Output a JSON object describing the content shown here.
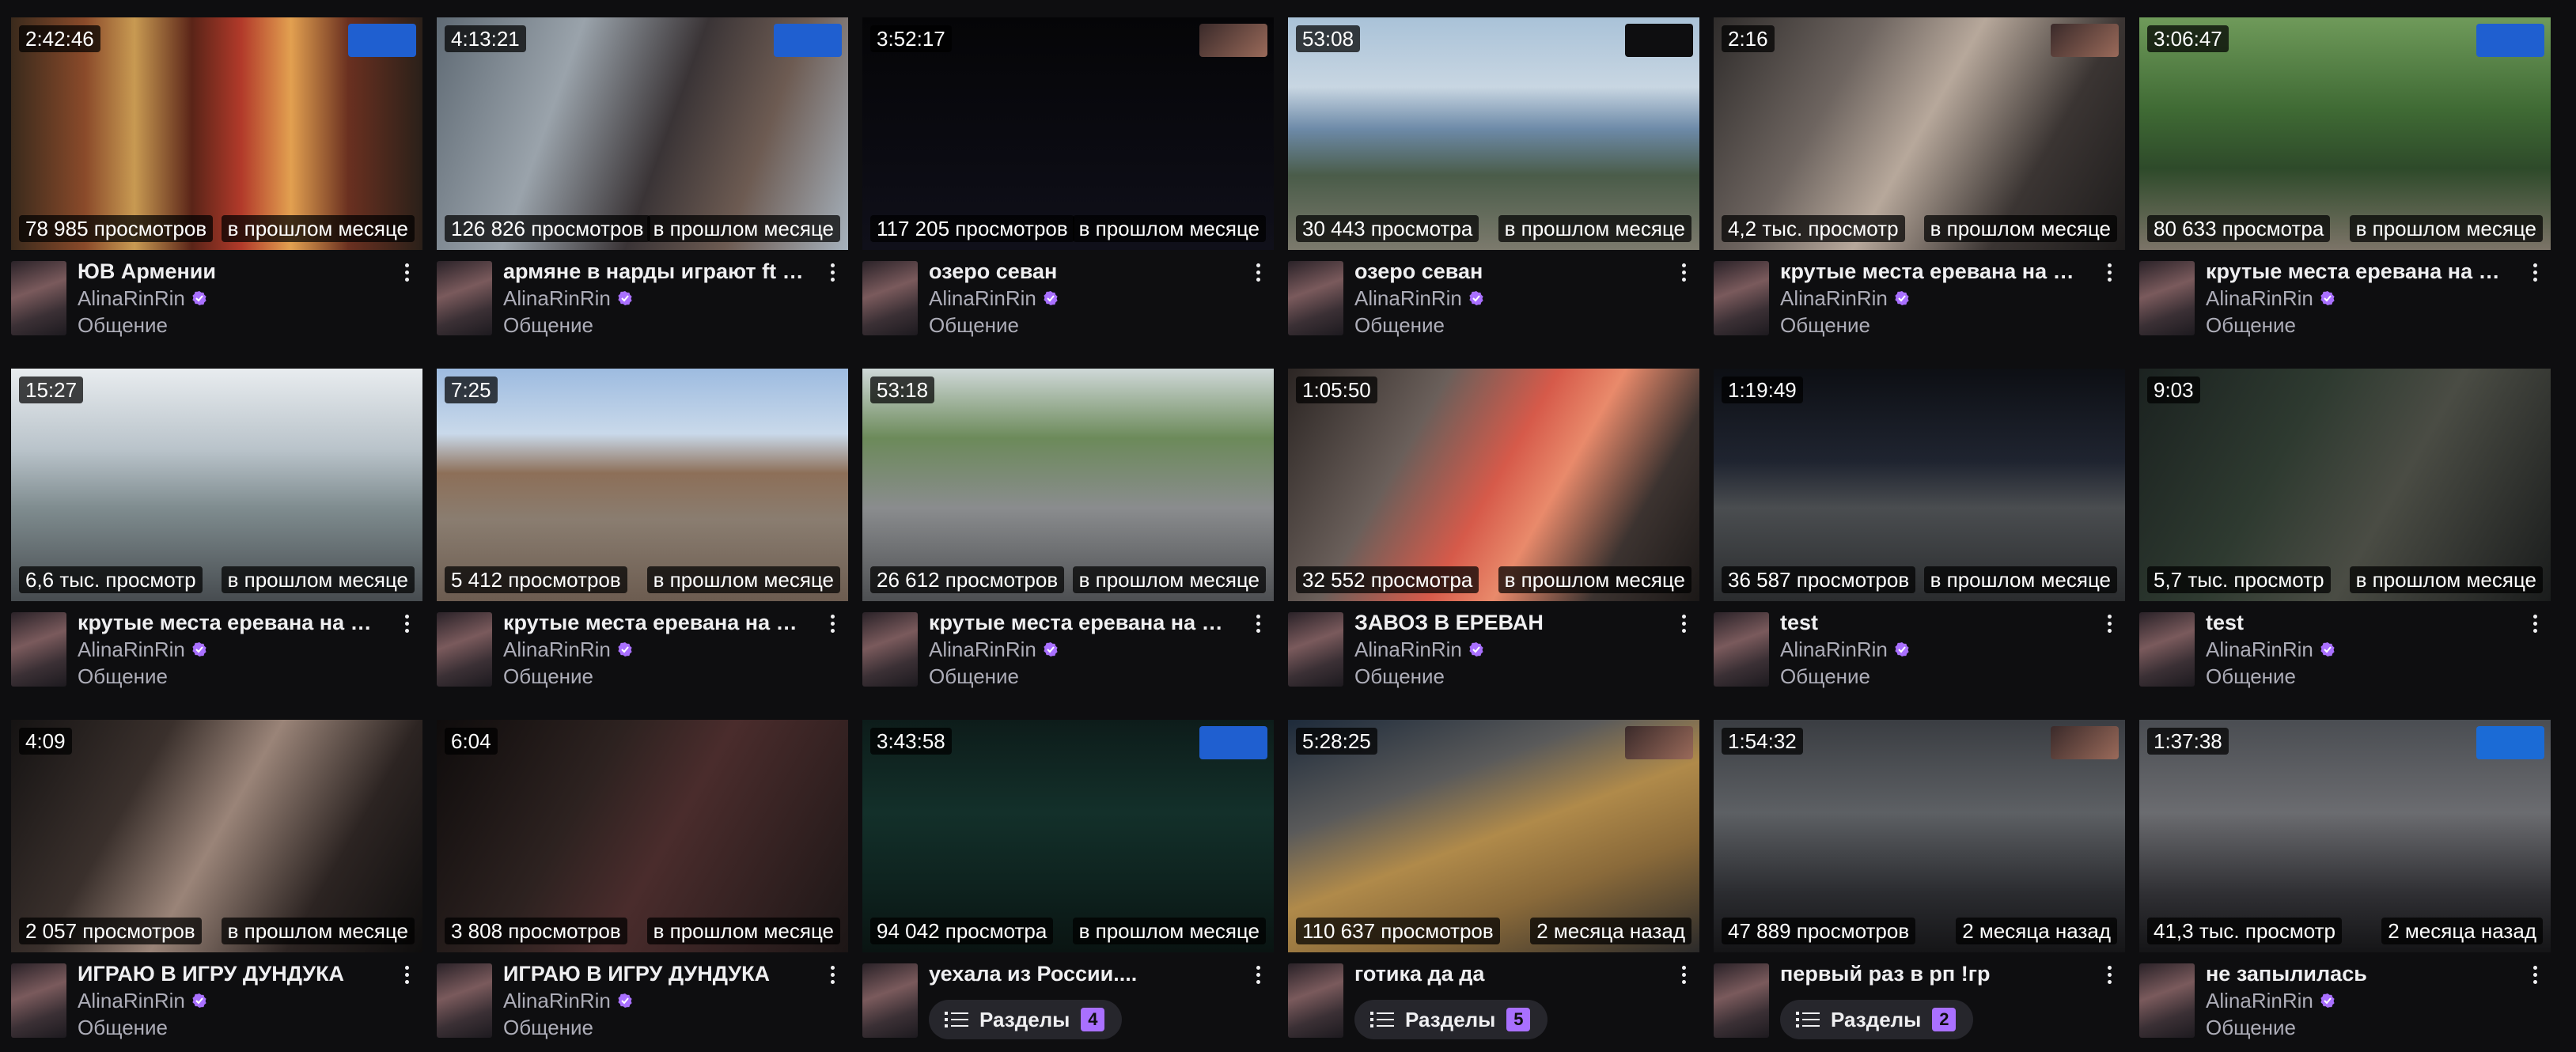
{
  "videos": [
    {
      "duration": "2:42:46",
      "views": "78 985 просмотров",
      "date": "в прошлом месяце",
      "title": "ЮВ Армении",
      "channel": "AlinaRinRin",
      "category": "Общение",
      "badge": "fu-pay-badge"
    },
    {
      "duration": "4:13:21",
      "views": "126 826 просмотров",
      "date": "в прошлом месяце",
      "title": "армяне в нарды играют ft @di...",
      "channel": "AlinaRinRin",
      "category": "Общение",
      "badge": "fu-pay-badge"
    },
    {
      "duration": "3:52:17",
      "views": "117 205 просмотров",
      "date": "в прошлом месяце",
      "title": "озеро севан",
      "channel": "AlinaRinRin",
      "category": "Общение",
      "badge": "streamer-badge"
    },
    {
      "duration": "53:08",
      "views": "30 443 просмотра",
      "date": "в прошлом месяце",
      "title": "озеро севан",
      "channel": "AlinaRinRin",
      "category": "Общение",
      "badge": "dark-badge"
    },
    {
      "duration": "2:16",
      "views": "4,2 тыс. просмотр",
      "date": "в прошлом месяце",
      "title": "крутые места еревана на ста...",
      "channel": "AlinaRinRin",
      "category": "Общение",
      "badge": "streamer-badge"
    },
    {
      "duration": "3:06:47",
      "views": "80 633 просмотра",
      "date": "в прошлом месяце",
      "title": "крутые места еревана на ста...",
      "channel": "AlinaRinRin",
      "category": "Общение",
      "badge": "fu-pay-badge"
    },
    {
      "duration": "15:27",
      "views": "6,6 тыс. просмотр",
      "date": "в прошлом месяце",
      "title": "крутые места еревана на ста...",
      "channel": "AlinaRinRin",
      "category": "Общение",
      "badge": ""
    },
    {
      "duration": "7:25",
      "views": "5 412 просмотров",
      "date": "в прошлом месяце",
      "title": "крутые места еревана на ста...",
      "channel": "AlinaRinRin",
      "category": "Общение",
      "badge": ""
    },
    {
      "duration": "53:18",
      "views": "26 612 просмотров",
      "date": "в прошлом месяце",
      "title": "крутые места еревана на ста...",
      "channel": "AlinaRinRin",
      "category": "Общение",
      "badge": ""
    },
    {
      "duration": "1:05:50",
      "views": "32 552 просмотра",
      "date": "в прошлом месяце",
      "title": "ЗАВОЗ В ЕРЕВАН",
      "channel": "AlinaRinRin",
      "category": "Общение",
      "badge": ""
    },
    {
      "duration": "1:19:49",
      "views": "36 587 просмотров",
      "date": "в прошлом месяце",
      "title": "test",
      "channel": "AlinaRinRin",
      "category": "Общение",
      "badge": ""
    },
    {
      "duration": "9:03",
      "views": "5,7 тыс. просмотр",
      "date": "в прошлом месяце",
      "title": "test",
      "channel": "AlinaRinRin",
      "category": "Общение",
      "badge": ""
    },
    {
      "duration": "4:09",
      "views": "2 057 просмотров",
      "date": "в прошлом месяце",
      "title": "ИГРАЮ В ИГРУ ДУНДУКА",
      "channel": "AlinaRinRin",
      "category": "Общение",
      "badge": ""
    },
    {
      "duration": "6:04",
      "views": "3 808 просмотров",
      "date": "в прошлом месяце",
      "title": "ИГРАЮ В ИГРУ ДУНДУКА",
      "channel": "AlinaRinRin",
      "category": "Общение",
      "badge": ""
    },
    {
      "duration": "3:43:58",
      "views": "94 042 просмотра",
      "date": "в прошлом месяце",
      "title": "уехала из России....",
      "channel": "",
      "category": "",
      "badge": "fu-pay-badge",
      "chapters_label": "Разделы",
      "chapters_count": "4"
    },
    {
      "duration": "5:28:25",
      "views": "110 637 просмотров",
      "date": "2 месяца назад",
      "title": "готика да да",
      "channel": "",
      "category": "",
      "badge": "streamer-badge",
      "chapters_label": "Разделы",
      "chapters_count": "5"
    },
    {
      "duration": "1:54:32",
      "views": "47 889 просмотров",
      "date": "2 месяца назад",
      "title": "первый раз в рп !гр",
      "channel": "",
      "category": "",
      "badge": "streamer-badge",
      "chapters_label": "Разделы",
      "chapters_count": "2"
    },
    {
      "duration": "1:37:38",
      "views": "41,3 тыс. просмотр",
      "date": "2 месяца назад",
      "title": "не запылилась",
      "channel": "AlinaRinRin",
      "category": "Общение",
      "badge": "steam-badge"
    }
  ],
  "colors": {
    "background": "#0e0e10",
    "accent": "#a970ff",
    "overlay": "rgba(0,0,0,0.72)",
    "text": "#efeff1",
    "muted": "#adadb8"
  },
  "icons": {
    "verified": "verified-check-icon",
    "more": "kebab-more-icon",
    "chapters": "chapters-list-icon"
  }
}
